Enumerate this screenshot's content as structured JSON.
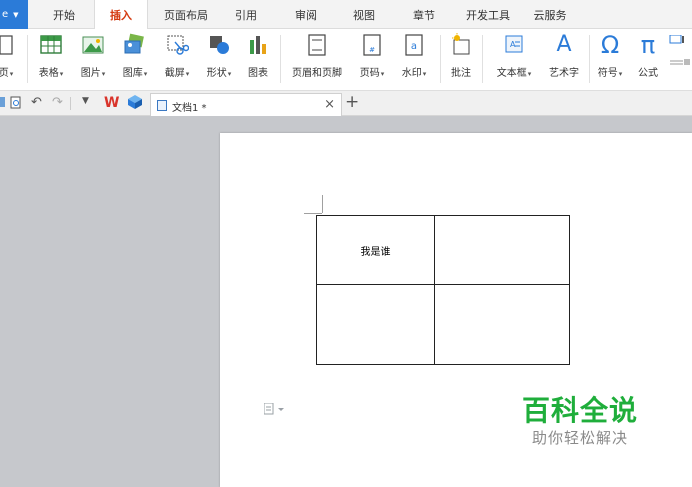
{
  "app_menu": {
    "label": "e"
  },
  "tabs": [
    "开始",
    "插入",
    "页面布局",
    "引用",
    "审阅",
    "视图",
    "章节",
    "开发工具",
    "云服务"
  ],
  "active_tab": "插入",
  "ribbon": {
    "page": "页",
    "table": "表格",
    "picture": "图片",
    "gallery": "图库",
    "screenshot": "截屏",
    "shape": "形状",
    "chart": "图表",
    "header_footer": "页眉和页脚",
    "page_number": "页码",
    "watermark": "水印",
    "comment": "批注",
    "textbox": "文本框",
    "wordart": "艺术字",
    "symbol": "符号",
    "formula": "公式",
    "symbol_glyph": "Ω",
    "formula_glyph": "π",
    "wordart_glyph": "A"
  },
  "document": {
    "tab_name": "文档1 *",
    "table": [
      [
        "我是谁",
        ""
      ],
      [
        "",
        ""
      ]
    ]
  },
  "watermark": {
    "title": "百科全说",
    "subtitle": "助你轻松解决"
  },
  "colors": {
    "accent": "#2b7bd8",
    "active_tab_text": "#d4380d",
    "watermark_green": "#1fae3b"
  }
}
